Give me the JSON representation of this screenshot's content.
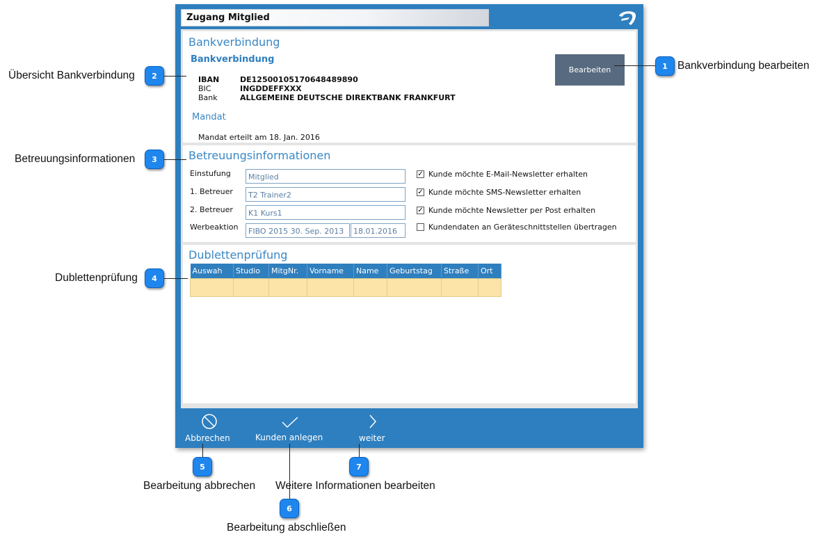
{
  "window": {
    "title": "Zugang Mitglied"
  },
  "bank": {
    "panel_title": "Bankverbindung",
    "sub_title": "Bankverbindung",
    "iban_label": "IBAN",
    "iban_value": "DE12500105170648489890",
    "bic_label": "BIC",
    "bic_value": "INGDDEFFXXX",
    "bank_label": "Bank",
    "bank_value": "ALLGEMEINE DEUTSCHE DIREKTBANK FRANKFURT",
    "mandat_title": "Mandat",
    "mandat_text": "Mandat erteilt am 18. Jan. 2016",
    "edit_label": "Bearbeiten"
  },
  "care": {
    "panel_title": "Betreuungsinformationen",
    "einstufung_label": "Einstufung",
    "einstufung_value": "Mitglied",
    "betreuer1_label": "1. Betreuer",
    "betreuer1_value": "T2 Trainer2",
    "betreuer2_label": "2. Betreuer",
    "betreuer2_value": "K1 Kurs1",
    "werbeaktion_label": "Werbeaktion",
    "werbeaktion_value": "FIBO 2015 30. Sep. 2013",
    "werbeaktion_date": "18.01.2016",
    "checkboxes": [
      {
        "label": "Kunde möchte E-Mail-Newsletter erhalten",
        "checked": true
      },
      {
        "label": "Kunde möchte SMS-Newsletter erhalten",
        "checked": true
      },
      {
        "label": "Kunde möchte Newsletter per Post erhalten",
        "checked": true
      },
      {
        "label": "Kundendaten an Geräteschnittstellen übertragen",
        "checked": false
      }
    ]
  },
  "dup": {
    "panel_title": "Dublettenprüfung",
    "columns": [
      "Auswah",
      "Studio",
      "MitgNr.",
      "Vorname",
      "Name",
      "Geburtstag",
      "Straße",
      "Ort"
    ]
  },
  "toolbar": {
    "cancel_label": "Abbrechen",
    "create_label": "Kunden anlegen",
    "next_label": "weiter"
  },
  "callouts": {
    "c1": {
      "num": "1",
      "text": "Bankverbindung bearbeiten"
    },
    "c2": {
      "num": "2",
      "text": "Übersicht Bankverbindung"
    },
    "c3": {
      "num": "3",
      "text": "Betreuungsinformationen"
    },
    "c4": {
      "num": "4",
      "text": "Dublettenprüfung"
    },
    "c5": {
      "num": "5",
      "text": "Bearbeitung abbrechen"
    },
    "c6": {
      "num": "6",
      "text": "Bearbeitung abschließen"
    },
    "c7": {
      "num": "7",
      "text": "Weitere Informationen bearbeiten"
    }
  },
  "colors": {
    "accent": "#2d7fbf",
    "button": "#586a7f",
    "badge": "#1f86ee",
    "table_row": "#fce4a8"
  }
}
